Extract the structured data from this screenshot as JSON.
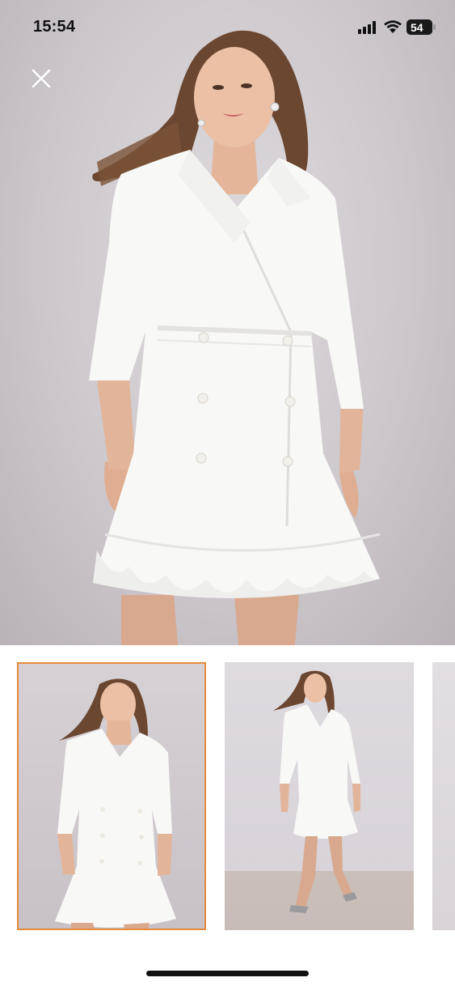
{
  "status_bar": {
    "time": "15:54",
    "battery_level": "54",
    "icons": [
      "cellular-signal-icon",
      "wifi-icon",
      "battery-icon"
    ]
  },
  "viewer": {
    "close_icon": "close-icon",
    "main_image": "model-white-double-breasted-dress-photo",
    "thumbnails": [
      {
        "image": "model-dress-front-closeup-thumbnail",
        "selected": true
      },
      {
        "image": "model-dress-full-length-walking-thumbnail",
        "selected": false
      },
      {
        "image": "partial-next-thumbnail",
        "selected": false
      }
    ]
  },
  "colors": {
    "selected_border": "#e88a3c",
    "background": "#ffffff"
  }
}
